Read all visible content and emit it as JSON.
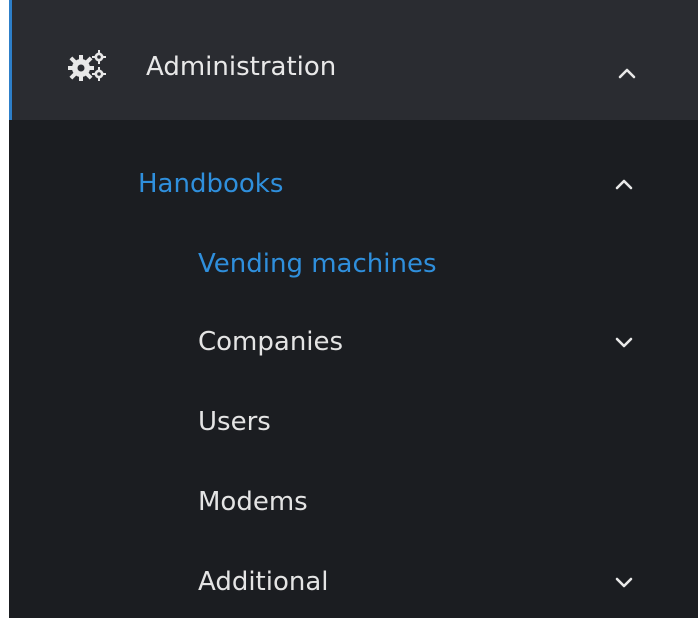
{
  "admin": {
    "label": "Administration",
    "icon": "gears-icon",
    "expanded": true
  },
  "handbooks": {
    "label": "Handbooks",
    "expanded": true
  },
  "items": [
    {
      "label": "Vending machines",
      "active": true
    },
    {
      "label": "Companies",
      "expandable": true
    },
    {
      "label": "Users"
    },
    {
      "label": "Modems"
    },
    {
      "label": "Additional",
      "expandable": true
    }
  ],
  "colors": {
    "header_bg": "#2a2c31",
    "sidebar_bg": "#1b1d21",
    "accent": "#2f8fdc",
    "text": "#e4e4e4"
  }
}
